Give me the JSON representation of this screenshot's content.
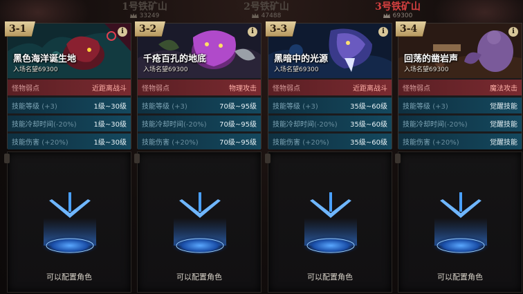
{
  "mines": [
    {
      "name": "1号铁矿山",
      "rep": "33249",
      "active": false
    },
    {
      "name": "2号铁矿山",
      "rep": "47488",
      "active": false
    },
    {
      "name": "3号铁矿山",
      "rep": "69300",
      "active": true
    }
  ],
  "cards": [
    {
      "stage": "3-1",
      "title": "黑色海洋诞生地",
      "entry": "入场名望69300",
      "weak_label": "怪物弱点",
      "weak_value": "近距离战斗",
      "rows": [
        {
          "label": "技能等级",
          "mod": "(+3)",
          "value": "1级~30级"
        },
        {
          "label": "技能冷却时间",
          "mod": "(-20%)",
          "value": "1级~30级"
        },
        {
          "label": "技能伤害",
          "mod": "(+20%)",
          "value": "1级~30级"
        }
      ],
      "slot_text": "可以配置角色"
    },
    {
      "stage": "3-2",
      "title": "千疮百孔的地底",
      "entry": "入场名望69300",
      "weak_label": "怪物弱点",
      "weak_value": "物理攻击",
      "rows": [
        {
          "label": "技能等级",
          "mod": "(+3)",
          "value": "70级~95级"
        },
        {
          "label": "技能冷却时间",
          "mod": "(-20%)",
          "value": "70级~95级"
        },
        {
          "label": "技能伤害",
          "mod": "(+20%)",
          "value": "70级~95级"
        }
      ],
      "slot_text": "可以配置角色"
    },
    {
      "stage": "3-3",
      "title": "黑暗中的光源",
      "entry": "入场名望69300",
      "weak_label": "怪物弱点",
      "weak_value": "近距离战斗",
      "rows": [
        {
          "label": "技能等级",
          "mod": "(+3)",
          "value": "35级~60级"
        },
        {
          "label": "技能冷却时间",
          "mod": "(-20%)",
          "value": "35级~60级"
        },
        {
          "label": "技能伤害",
          "mod": "(+20%)",
          "value": "35级~60级"
        }
      ],
      "slot_text": "可以配置角色"
    },
    {
      "stage": "3-4",
      "title": "回荡的凿岩声",
      "entry": "入场名望69300",
      "weak_label": "怪物弱点",
      "weak_value": "魔法攻击",
      "rows": [
        {
          "label": "技能等级",
          "mod": "(+3)",
          "value": "觉醒技能"
        },
        {
          "label": "技能冷却时间",
          "mod": "(-20%)",
          "value": "觉醒技能"
        },
        {
          "label": "技能伤害",
          "mod": "(+20%)",
          "value": "觉醒技能"
        }
      ],
      "slot_text": "可以配置角色"
    }
  ],
  "info_glyph": "i",
  "icons": {
    "info": "info-icon",
    "crown": "crown-icon",
    "arrow": "down-arrow-icon"
  }
}
